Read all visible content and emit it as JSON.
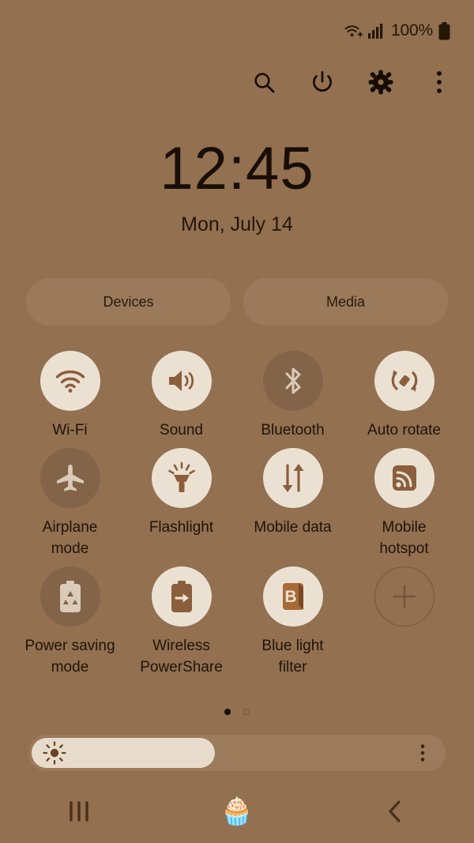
{
  "statusbar": {
    "wifi_icon": "wifi-plus-icon",
    "signal_icon": "cellular-signal-icon",
    "battery_percent": "100%",
    "battery_icon": "battery-full-icon"
  },
  "toolbar": {
    "items": [
      {
        "name": "search-icon",
        "label": "Search"
      },
      {
        "name": "power-icon",
        "label": "Power"
      },
      {
        "name": "settings-icon",
        "label": "Settings"
      },
      {
        "name": "more-icon",
        "label": "More options"
      }
    ]
  },
  "clock": {
    "time": "12:45",
    "date": "Mon, July 14"
  },
  "pills": [
    {
      "label": "Devices"
    },
    {
      "label": "Media"
    }
  ],
  "quick_settings": [
    {
      "label": "Wi-Fi",
      "icon": "wifi-icon",
      "state": "on"
    },
    {
      "label": "Sound",
      "icon": "sound-icon",
      "state": "on"
    },
    {
      "label": "Bluetooth",
      "icon": "bluetooth-icon",
      "state": "off"
    },
    {
      "label": "Auto rotate",
      "icon": "auto-rotate-icon",
      "state": "on"
    },
    {
      "label": "Airplane mode",
      "icon": "airplane-icon",
      "state": "off"
    },
    {
      "label": "Flashlight",
      "icon": "flashlight-icon",
      "state": "on"
    },
    {
      "label": "Mobile data",
      "icon": "mobile-data-icon",
      "state": "on"
    },
    {
      "label": "Mobile hotspot",
      "icon": "mobile-hotspot-icon",
      "state": "on"
    },
    {
      "label": "Power saving mode",
      "icon": "power-saving-icon",
      "state": "off"
    },
    {
      "label": "Wireless PowerShare",
      "icon": "powershare-icon",
      "state": "on"
    },
    {
      "label": "Blue light filter",
      "icon": "blue-light-icon",
      "state": "on"
    },
    {
      "label": "",
      "icon": "add-icon",
      "state": "add"
    }
  ],
  "pagination": {
    "pages": 2,
    "active_page": 1
  },
  "brightness": {
    "value_percent": 44,
    "left_icon": "brightness-sun-icon",
    "menu_icon": "more-icon"
  },
  "navbar": {
    "recents_label": "Recent apps",
    "home_glyph": "🧁",
    "back_label": "Back"
  },
  "colors": {
    "background": "#927050",
    "tile_on_bg": "#EBE1D3",
    "tile_off_bg": "#836449",
    "icon_on": "#8B5E3C",
    "icon_off": "#D9CBB8",
    "pill_bg": "#9A7A5A",
    "text": "#201409"
  }
}
